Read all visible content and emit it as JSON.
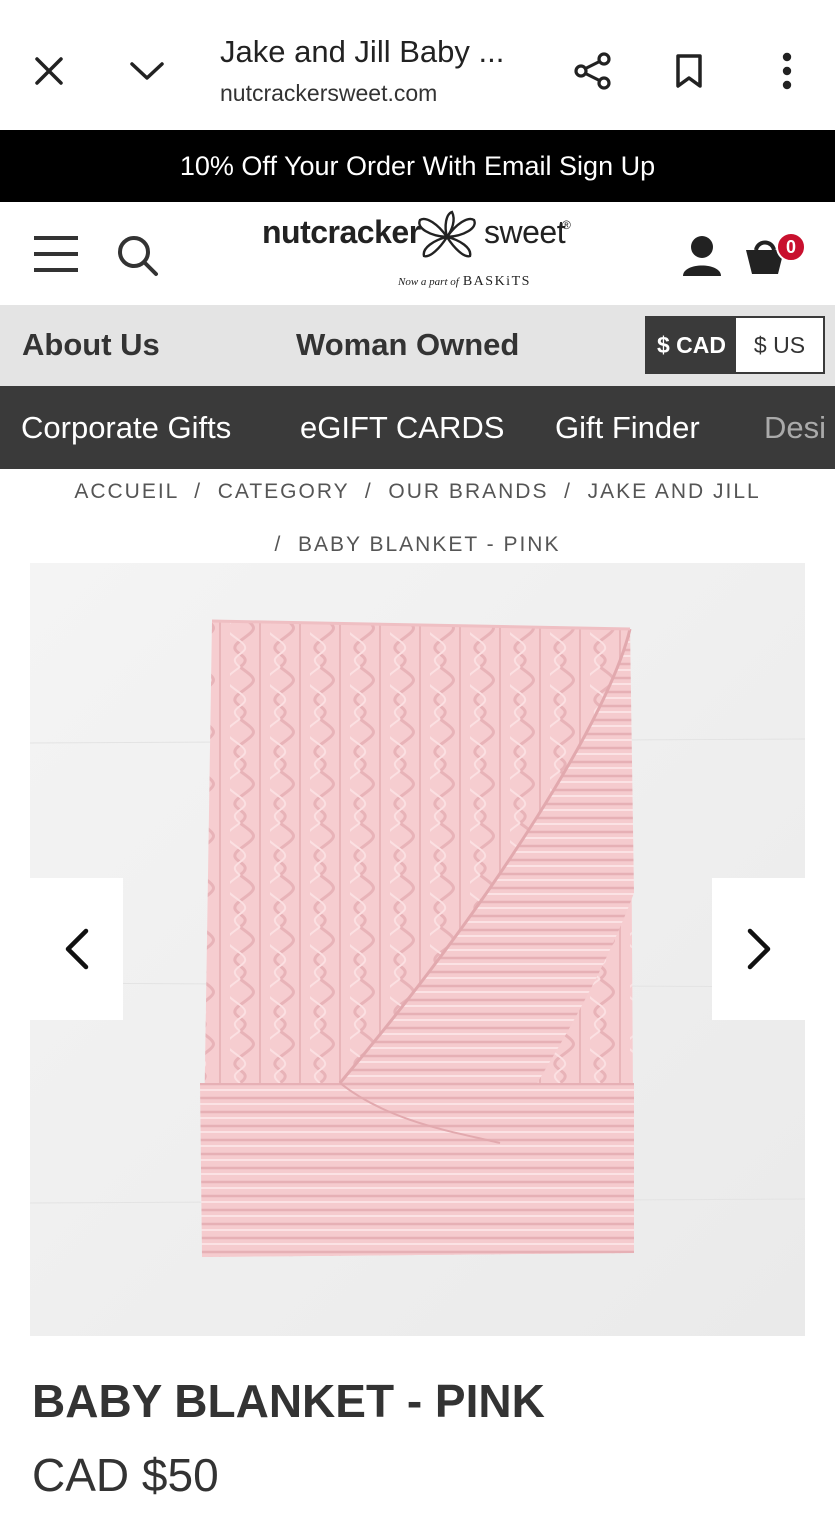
{
  "browser": {
    "title": "Jake and Jill Baby ...",
    "url": "nutcrackersweet.com",
    "icons": [
      "close-icon",
      "chevron-down-icon",
      "share-icon",
      "bookmark-icon",
      "more-vert-icon"
    ]
  },
  "promo": {
    "text": "10% Off Your Order With Email Sign Up"
  },
  "header": {
    "logo_left": "nutcracker",
    "logo_right": "sweet",
    "logo_trademark": "®",
    "logo_tagline_script": "Now a part of",
    "logo_tagline_brand": "BASKiTS",
    "cart_count": "0",
    "accent_color": "#c8102e"
  },
  "subnav": {
    "items": [
      "About Us",
      "Woman Owned"
    ],
    "currency": {
      "selected": "$ CAD",
      "other": "$ US"
    }
  },
  "mainnav": {
    "items": [
      "Corporate Gifts",
      "eGIFT CARDS",
      "Gift Finder",
      "Desi"
    ]
  },
  "breadcrumb": {
    "line1": "ACCUEIL  /  CATEGORY  /  OUR BRANDS  /  JAKE AND JILL",
    "line2": "/  BABY BLANKET - PINK"
  },
  "product": {
    "title": "BABY BLANKET - PINK",
    "price": "CAD $50",
    "color": "#f4c6c9"
  }
}
